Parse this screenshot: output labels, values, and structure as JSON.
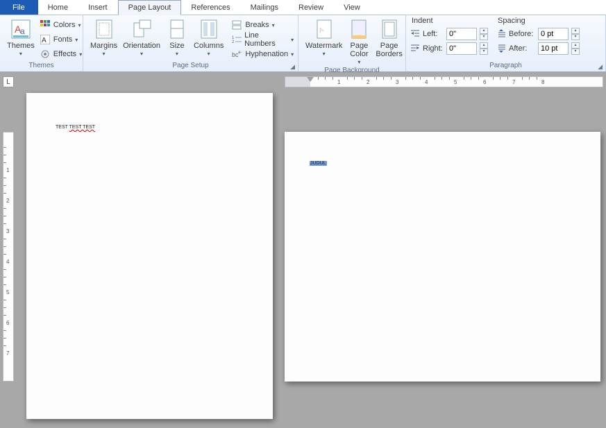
{
  "tabs": {
    "file": "File",
    "items": [
      "Home",
      "Insert",
      "Page Layout",
      "References",
      "Mailings",
      "Review",
      "View"
    ],
    "activeIndex": 2
  },
  "ribbon": {
    "themes": {
      "label": "Themes",
      "themes_btn": "Themes",
      "colors": "Colors",
      "fonts": "Fonts",
      "effects": "Effects"
    },
    "pagesetup": {
      "label": "Page Setup",
      "margins": "Margins",
      "orientation": "Orientation",
      "size": "Size",
      "columns": "Columns",
      "breaks": "Breaks",
      "line_numbers": "Line Numbers",
      "hyphenation": "Hyphenation"
    },
    "pagebg": {
      "label": "Page Background",
      "watermark": "Watermark",
      "page_color": "Page\nColor",
      "page_borders": "Page\nBorders"
    },
    "indent": {
      "heading": "Indent",
      "left_label": "Left:",
      "left_value": "0\"",
      "right_label": "Right:",
      "right_value": "0\""
    },
    "spacing": {
      "heading": "Spacing",
      "before_label": "Before:",
      "before_value": "0 pt",
      "after_label": "After:",
      "after_value": "10 pt"
    },
    "paragraph_label": "Paragraph"
  },
  "ruler": {
    "h_numbers": [
      1,
      2,
      3,
      4,
      5,
      6,
      7,
      8
    ]
  },
  "vruler_numbers": [
    1,
    2,
    3,
    4,
    5,
    6,
    7
  ],
  "doc": {
    "page1_prefix": "TEST ",
    "page1_wavy": "TEST TEST",
    "page2_sel": "JUDUL"
  },
  "tabselector": "L"
}
